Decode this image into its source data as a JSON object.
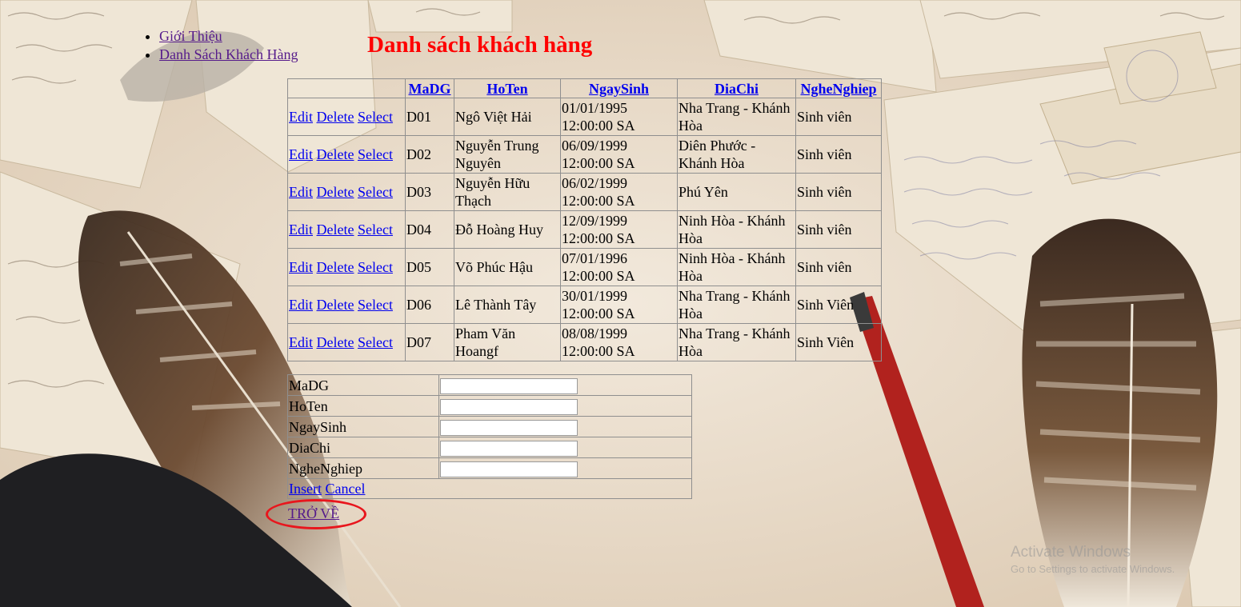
{
  "nav": [
    {
      "label": "Giới Thiệu"
    },
    {
      "label": "Danh Sách Khách Hàng"
    }
  ],
  "page_title": "Danh sách khách hàng",
  "grid": {
    "headers": [
      "MaDG",
      "HoTen",
      "NgaySinh",
      "DiaChi",
      "NgheNghiep"
    ],
    "commands": {
      "edit": "Edit",
      "delete": "Delete",
      "select": "Select"
    },
    "rows": [
      {
        "madg": "D01",
        "hoten": "Ngô Việt Hải",
        "ngaysinh": "01/01/1995 12:00:00 SA",
        "diachi": "Nha Trang - Khánh Hòa",
        "nghenghiep": "Sinh viên"
      },
      {
        "madg": "D02",
        "hoten": "Nguyễn Trung Nguyên",
        "ngaysinh": "06/09/1999 12:00:00 SA",
        "diachi": "Diên Phước - Khánh Hòa",
        "nghenghiep": "Sinh viên"
      },
      {
        "madg": "D03",
        "hoten": "Nguyễn Hữu Thạch",
        "ngaysinh": "06/02/1999 12:00:00 SA",
        "diachi": "Phú Yên",
        "nghenghiep": "Sinh viên"
      },
      {
        "madg": "D04",
        "hoten": "Đỗ Hoàng Huy",
        "ngaysinh": "12/09/1999 12:00:00 SA",
        "diachi": "Ninh Hòa - Khánh Hòa",
        "nghenghiep": "Sinh viên"
      },
      {
        "madg": "D05",
        "hoten": "Võ Phúc Hậu",
        "ngaysinh": "07/01/1996 12:00:00 SA",
        "diachi": "Ninh Hòa - Khánh Hòa",
        "nghenghiep": "Sinh viên"
      },
      {
        "madg": "D06",
        "hoten": "Lê Thành Tây",
        "ngaysinh": "30/01/1999 12:00:00 SA",
        "diachi": "Nha Trang - Khánh Hòa",
        "nghenghiep": "Sinh Viên"
      },
      {
        "madg": "D07",
        "hoten": "Pham Văn Hoangf",
        "ngaysinh": "08/08/1999 12:00:00 SA",
        "diachi": "Nha Trang - Khánh Hòa",
        "nghenghiep": "Sinh Viên"
      }
    ]
  },
  "form": {
    "fields": [
      {
        "label": "MaDG",
        "value": ""
      },
      {
        "label": "HoTen",
        "value": ""
      },
      {
        "label": "NgaySinh",
        "value": ""
      },
      {
        "label": "DiaChi",
        "value": ""
      },
      {
        "label": "NgheNghiep",
        "value": ""
      }
    ],
    "insert_label": "Insert",
    "cancel_label": "Cancel"
  },
  "back_link": "TRỞ VỀ",
  "annotation_color": "#e8161d",
  "watermark": {
    "line1": "Activate Windows",
    "line2": "Go to Settings to activate Windows."
  }
}
